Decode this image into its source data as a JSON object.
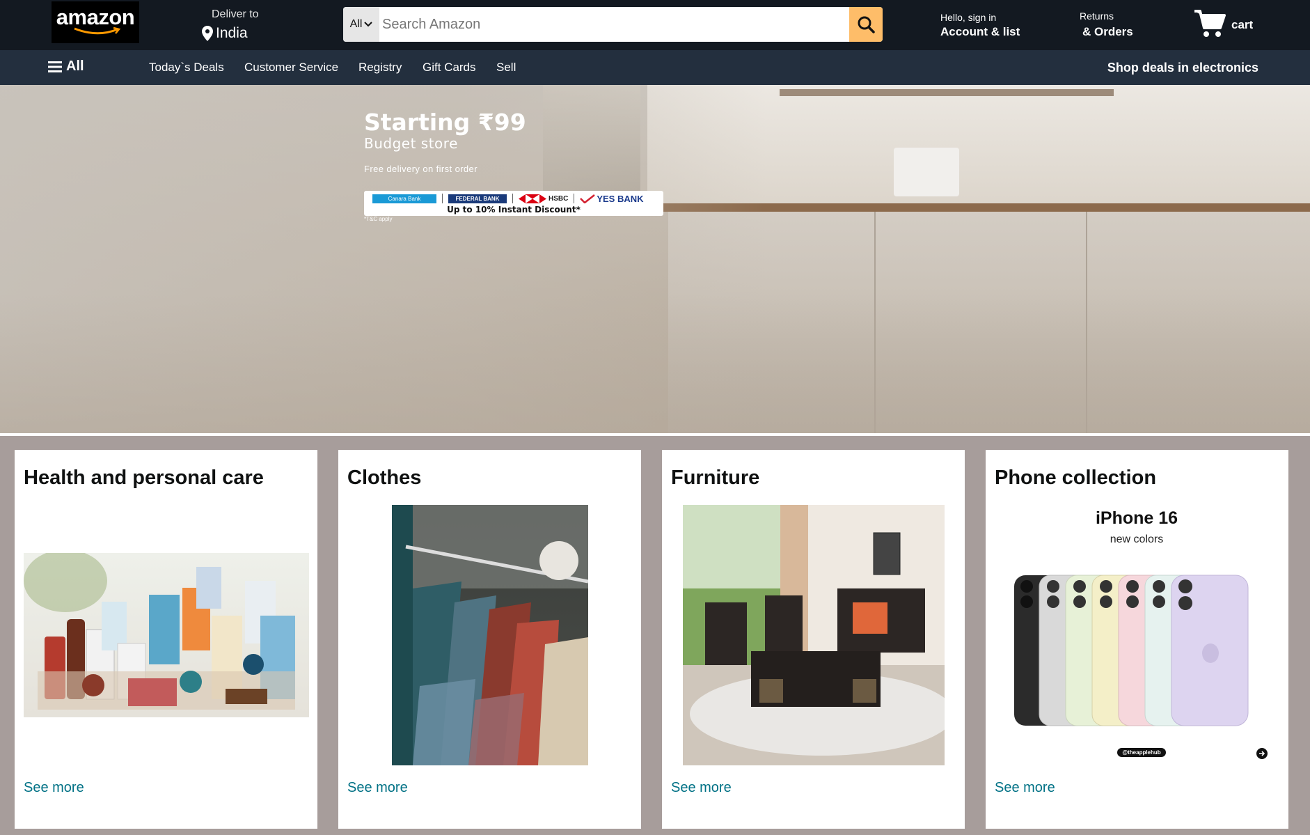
{
  "header": {
    "logo_text": "amazon",
    "deliver_label": "Deliver to",
    "deliver_country": "India",
    "search": {
      "category": "All",
      "placeholder": "Search Amazon"
    },
    "account_greeting": "Hello, sign in",
    "account_label": "Account & list",
    "returns_label": "Returns",
    "orders_label": "& Orders",
    "cart_label": "cart"
  },
  "subnav": {
    "all_label": "All",
    "links": [
      "Today`s Deals",
      "Customer Service",
      "Registry",
      "Gift Cards",
      "Sell"
    ],
    "promo": "Shop deals in electronics"
  },
  "hero": {
    "title": "Starting",
    "price": "₹99",
    "subtitle": "Budget store",
    "note": "Free delivery on first order",
    "banks": {
      "canara": "Canara Bank",
      "federal": "FEDERAL BANK",
      "hsbc": "HSBC",
      "yes": "YES BANK"
    },
    "discount": "Up to 10% Instant Discount*",
    "tc": "*T&C apply"
  },
  "cards": [
    {
      "title": "Health and personal care",
      "link": "See more"
    },
    {
      "title": "Clothes",
      "link": "See more"
    },
    {
      "title": "Furniture",
      "link": "See more"
    },
    {
      "title": "Phone collection",
      "link": "See more"
    }
  ],
  "phone_promo": {
    "headline": "iPhone 16",
    "sub": "new colors",
    "handle": "@theapplehub"
  },
  "colors": {
    "topbar": "#131921",
    "subnav": "#232f3e",
    "search_button": "#febd69",
    "link": "#007185",
    "page_bg": "#a79d9b"
  },
  "icons": [
    "location-pin-icon",
    "chevron-down-icon",
    "search-icon",
    "cart-icon",
    "hamburger-icon",
    "arrow-right-icon"
  ]
}
